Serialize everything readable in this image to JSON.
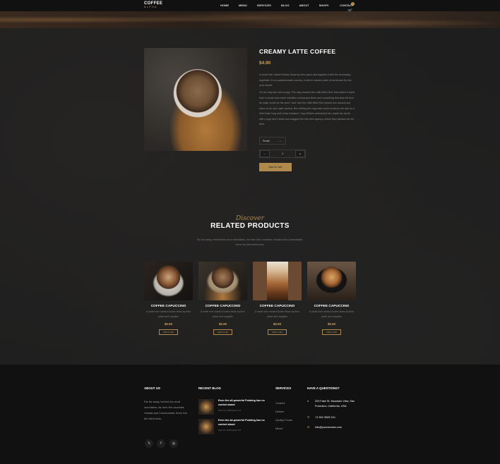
{
  "header": {
    "logo_line1": "COFFEE",
    "logo_line2": "ALPHA",
    "nav": [
      "HOME",
      "MENU",
      "SERVICES",
      "BLOG",
      "ABOUT",
      "SHOP",
      "CONTACT"
    ],
    "shop_caret": "▾",
    "cart_count": "0"
  },
  "product": {
    "title": "CREAMY LATTE COFFEE",
    "price": "$4.90",
    "desc1": "A small river named Duden flows by their place and supplies it with the necessary regelialia. It is a paradisematic country, in which roasted parts of sentences fly into your mouth.",
    "desc2": "On her way she met a copy. The copy warned the Little Blind Text, that where it came from it would have been rewritten a thousand times and everything that was left from its origin would be the word \"and\" and the Little Blind Text should turn around and return to its own, safe country. But nothing the copy said could convince her and so it didn't take long until a few insidious Copy Writers ambushed her, made her drunk with Longe and Parole and dragged her into their agency, where they abused her for their.",
    "size_label": "Small",
    "qty": "1",
    "minus": "−",
    "plus": "+",
    "add_to_cart": "Add to Cart"
  },
  "related": {
    "script_title": "Discover",
    "title": "RELATED PRODUCTS",
    "desc": "Far far away, behind the word mountains, far from the countries Vokalia and Consonantia, there live the blind texts.",
    "items": [
      {
        "name": "COFFEE CAPUCCINO",
        "desc": "A small river named Duden flows by their place and supplies",
        "price": "$5.90",
        "button": "Add to Cart"
      },
      {
        "name": "COFFEE CAPUCCINO",
        "desc": "A small river named Duden flows by their place and supplies",
        "price": "$5.90",
        "button": "Add to Cart"
      },
      {
        "name": "COFFEE CAPUCCINO",
        "desc": "A small river named Duden flows by their place and supplies",
        "price": "$5.90",
        "button": "Add to Cart"
      },
      {
        "name": "COFFEE CAPUCCINO",
        "desc": "A small river named Duden flows by their place and supplies",
        "price": "$5.90",
        "button": "Add to Cart"
      }
    ]
  },
  "footer": {
    "about_title": "ABOUT US",
    "about_text": "Far far away, behind the word mountains, far from the countries Vokalia and Consonantia, there live the blind texts.",
    "blog_title": "RECENT BLOG",
    "blog": [
      {
        "title": "Even the all-powerful Pointing has no control about",
        "meta": "Sept 15, 2018  admin  19"
      },
      {
        "title": "Even the all-powerful Pointing has no control about",
        "meta": "Sept 15, 2018  admin  19"
      }
    ],
    "services_title": "SERVICES",
    "services": [
      "Cooked",
      "Deliver",
      "Quality Foods",
      "Mixed"
    ],
    "contact_title": "HAVE A QUESTIONS?",
    "address": "203 Fake St. Mountain View, San Francisco, California, USA",
    "phone": "+2 392 3929 210",
    "email": "info@yourdomain.com"
  }
}
